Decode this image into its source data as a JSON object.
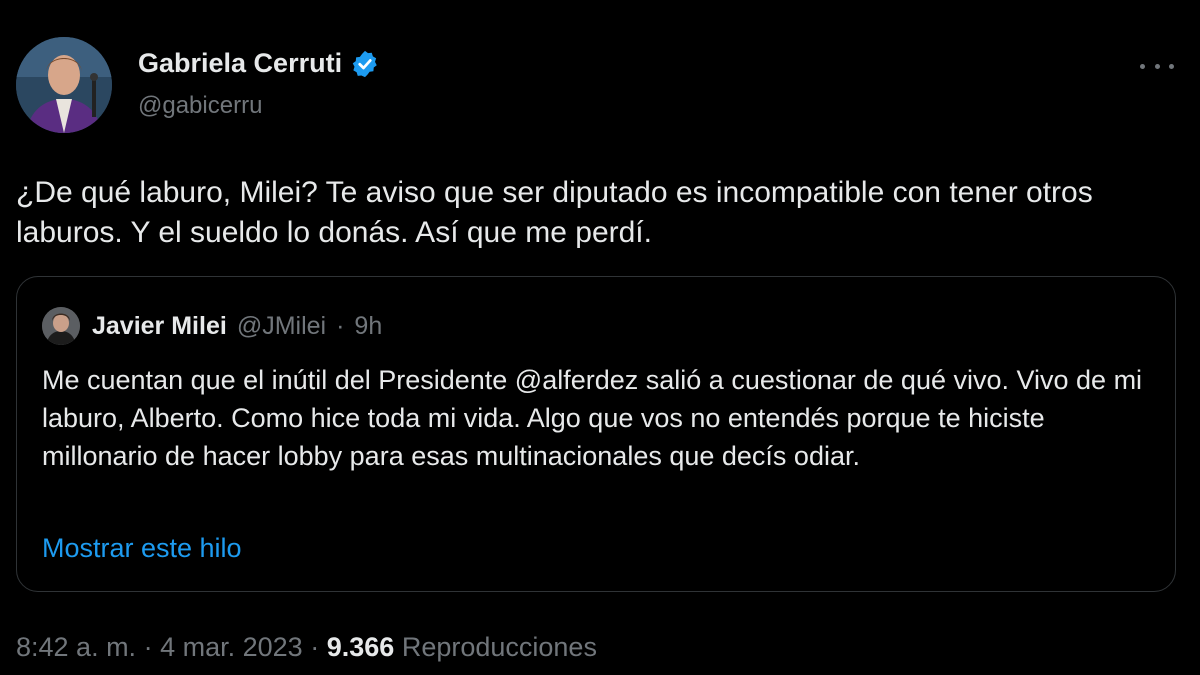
{
  "author": {
    "name": "Gabriela Cerruti",
    "handle": "@gabicerru",
    "verified_color": "#1d9bf0"
  },
  "tweet": {
    "text": "¿De qué laburo, Milei? Te aviso que ser diputado es incompatible con tener otros laburos. Y el sueldo lo donás. Así que me perdí."
  },
  "quote": {
    "name": "Javier Milei",
    "handle": "@JMilei",
    "separator": "·",
    "time": "9h",
    "text": "Me cuentan que el inútil del Presidente @alferdez salió a cuestionar de qué vivo. Vivo de mi laburo, Alberto. Como hice toda mi vida. Algo que vos no entendés porque te hiciste millonario de hacer lobby para esas multinacionales que decís odiar.",
    "show_thread": "Mostrar este hilo"
  },
  "footer": {
    "time": "8:42 a. m.",
    "separator": "·",
    "date": "4 mar. 2023",
    "views_count": "9.366",
    "views_label": "Reproducciones"
  },
  "icons": {
    "verified": "verified-badge-icon",
    "more": "more-options-icon"
  }
}
